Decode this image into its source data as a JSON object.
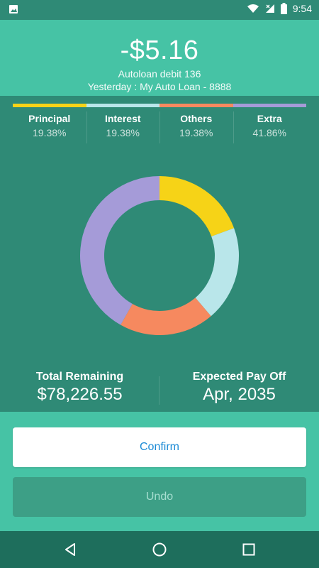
{
  "status_bar": {
    "time": "9:54"
  },
  "transaction": {
    "amount": "-$5.16",
    "description": "Autoloan debit 136",
    "detail": "Yesterday : My Auto Loan - 8888"
  },
  "breakdown": [
    {
      "label": "Principal",
      "percent": "19.38%",
      "color": "#f6d317"
    },
    {
      "label": "Interest",
      "percent": "19.38%",
      "color": "#b9e6ea"
    },
    {
      "label": "Others",
      "percent": "19.38%",
      "color": "#f6895f"
    },
    {
      "label": "Extra",
      "percent": "41.86%",
      "color": "#a59bd8"
    }
  ],
  "chart_data": {
    "type": "pie",
    "categories": [
      "Principal",
      "Interest",
      "Others",
      "Extra"
    ],
    "values": [
      19.38,
      19.38,
      19.38,
      41.86
    ],
    "colors": [
      "#f6d317",
      "#b9e6ea",
      "#f6895f",
      "#a59bd8"
    ],
    "donut": true
  },
  "totals": {
    "remaining_label": "Total Remaining",
    "remaining_value": "$78,226.55",
    "payoff_label": "Expected Pay Off",
    "payoff_value": "Apr, 2035"
  },
  "actions": {
    "confirm_label": "Confirm",
    "undo_label": "Undo"
  }
}
